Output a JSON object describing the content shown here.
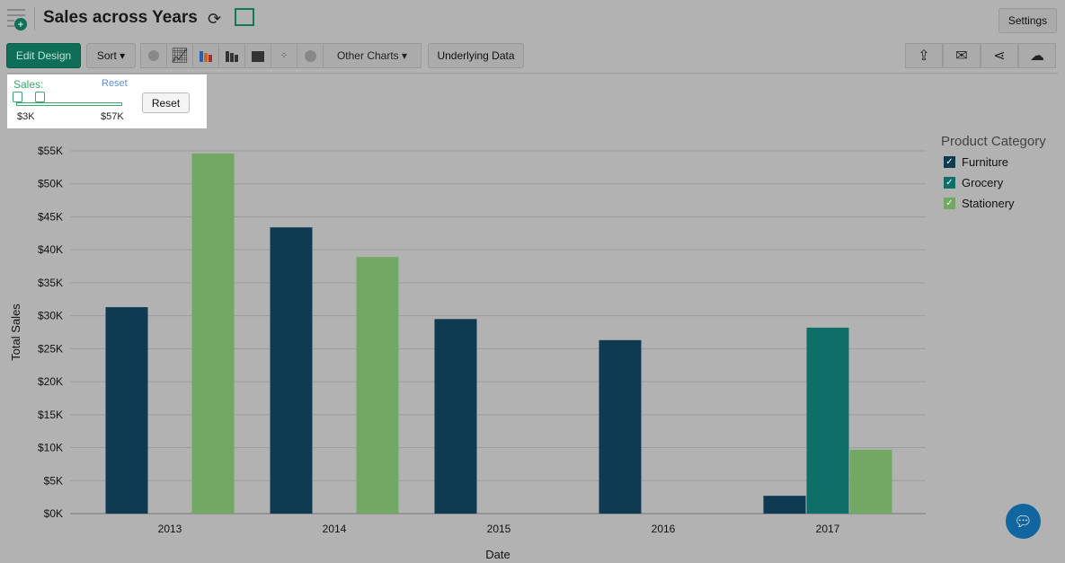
{
  "header": {
    "title": "Sales across Years",
    "settings_label": "Settings"
  },
  "toolbar": {
    "edit_design": "Edit Design",
    "sort": "Sort",
    "other_charts": "Other Charts",
    "underlying_data": "Underlying Data"
  },
  "filter": {
    "label": "Sales:",
    "reset_link": "Reset",
    "reset_button": "Reset",
    "min": "$3K",
    "max": "$57K"
  },
  "colors": {
    "Furniture": "#0e3a52",
    "Grocery": "#0e6f69",
    "Stationery": "#73a864"
  },
  "chart_data": {
    "type": "bar",
    "title": "Sales across Years",
    "xlabel": "Date",
    "ylabel": "Total Sales",
    "categories": [
      "2013",
      "2014",
      "2015",
      "2016",
      "2017"
    ],
    "series": [
      {
        "name": "Furniture",
        "values": [
          31.3,
          43.4,
          29.5,
          26.3,
          2.7
        ]
      },
      {
        "name": "Grocery",
        "values": [
          null,
          null,
          null,
          null,
          28.2
        ]
      },
      {
        "name": "Stationery",
        "values": [
          54.6,
          38.9,
          null,
          null,
          9.7
        ]
      }
    ],
    "ylim": [
      0,
      55
    ],
    "yticks": [
      "$0K",
      "$5K",
      "$10K",
      "$15K",
      "$20K",
      "$25K",
      "$30K",
      "$35K",
      "$40K",
      "$45K",
      "$50K",
      "$55K"
    ],
    "legend_title": "Product Category",
    "legend_position": "right",
    "grid": true
  }
}
